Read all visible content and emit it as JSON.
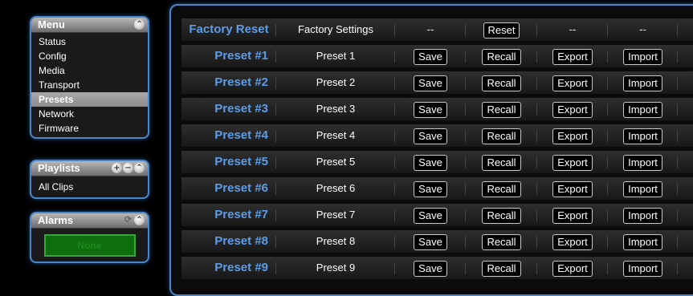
{
  "sidebar": {
    "menu": {
      "title": "Menu",
      "items": [
        {
          "label": "Status",
          "selected": false
        },
        {
          "label": "Config",
          "selected": false
        },
        {
          "label": "Media",
          "selected": false
        },
        {
          "label": "Transport",
          "selected": false
        },
        {
          "label": "Presets",
          "selected": true
        },
        {
          "label": "Network",
          "selected": false
        },
        {
          "label": "Firmware",
          "selected": false
        }
      ]
    },
    "playlists": {
      "title": "Playlists",
      "items": [
        {
          "label": "All Clips"
        }
      ]
    },
    "alarms": {
      "title": "Alarms",
      "status": "None",
      "status_color": "#0e6e0e"
    }
  },
  "colors": {
    "accent": "#4a86c8",
    "preset_name": "#5d9ce6",
    "selected_bg": "#9a9a9a"
  },
  "presets": {
    "factory": {
      "name": "Factory Reset",
      "description": "Factory Settings",
      "col3": "--",
      "action": "Reset",
      "col5": "--",
      "col6": "--"
    },
    "buttons": {
      "save": "Save",
      "recall": "Recall",
      "export": "Export",
      "import": "Import"
    },
    "rows": [
      {
        "name": "Preset #1",
        "label": "Preset 1"
      },
      {
        "name": "Preset #2",
        "label": "Preset 2"
      },
      {
        "name": "Preset #3",
        "label": "Preset 3"
      },
      {
        "name": "Preset #4",
        "label": "Preset 4"
      },
      {
        "name": "Preset #5",
        "label": "Preset 5"
      },
      {
        "name": "Preset #6",
        "label": "Preset 6"
      },
      {
        "name": "Preset #7",
        "label": "Preset 7"
      },
      {
        "name": "Preset #8",
        "label": "Preset 8"
      },
      {
        "name": "Preset #9",
        "label": "Preset 9"
      }
    ]
  }
}
